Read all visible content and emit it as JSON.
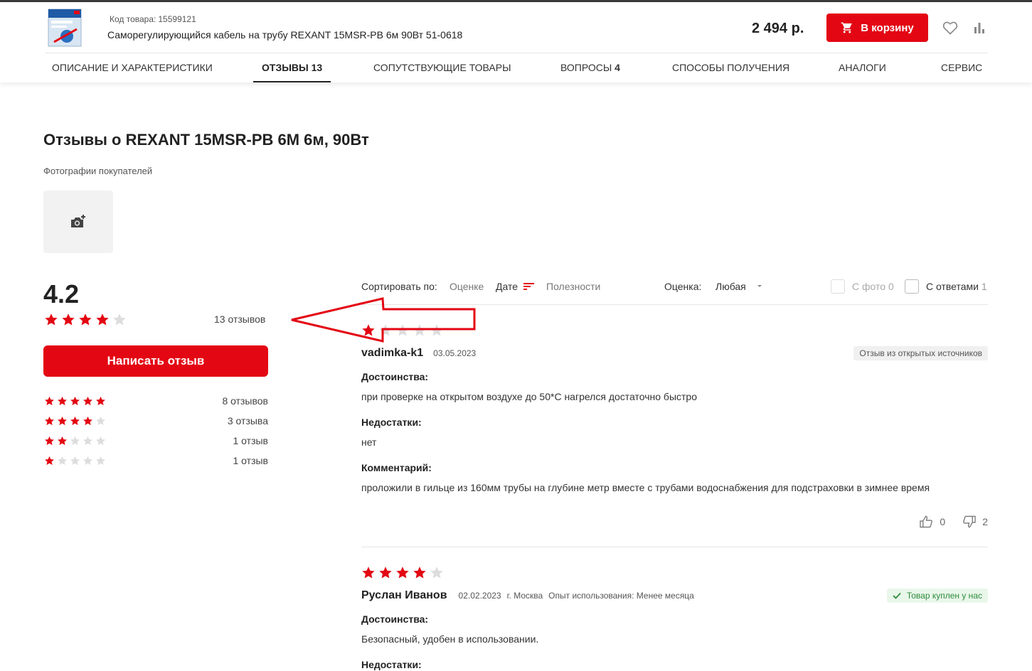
{
  "header": {
    "sku_label": "Код товара:",
    "sku_value": "15599121",
    "product_name": "Саморегулирующийся кабель на трубу REXANT 15MSR-PB 6м 90Вт 51-0618",
    "price": "2 494 р.",
    "cart_label": "В корзину",
    "icons": {
      "cart": "cart-icon",
      "favorite": "heart-icon",
      "compare": "compare-bars-icon"
    }
  },
  "tabs": [
    {
      "label": "ОПИСАНИЕ И ХАРАКТЕРИСТИКИ",
      "count": ""
    },
    {
      "label": "ОТЗЫВЫ",
      "count": "13",
      "active": true
    },
    {
      "label": "СОПУТСТВУЮЩИЕ ТОВАРЫ",
      "count": ""
    },
    {
      "label": "ВОПРОСЫ",
      "count": "4"
    },
    {
      "label": "СПОСОБЫ ПОЛУЧЕНИЯ",
      "count": ""
    },
    {
      "label": "АНАЛОГИ",
      "count": ""
    },
    {
      "label": "СЕРВИС",
      "count": ""
    }
  ],
  "main": {
    "title": "Отзывы о REXANT 15MSR-PB 6M 6м, 90Вт",
    "photos_label": "Фотографии покупателей",
    "add_photo_icon": "camera-plus-icon"
  },
  "summary": {
    "rating": "4.2",
    "rating_value": 4.2,
    "stars_filled": 4,
    "total_label": "13 отзывов",
    "write_button": "Написать отзыв",
    "distribution": [
      {
        "stars": 5,
        "label": "8 отзывов"
      },
      {
        "stars": 4,
        "label": "3 отзыва"
      },
      {
        "stars": 2,
        "label": "1 отзыв"
      },
      {
        "stars": 1,
        "label": "1 отзыв"
      }
    ]
  },
  "sort": {
    "label": "Сортировать по:",
    "options": [
      "Оценке",
      "Дате",
      "Полезности"
    ],
    "active": "Дате",
    "rating_filter_label": "Оценка:",
    "rating_filter_value": "Любая",
    "with_photo_label": "С фото",
    "with_photo_count": "0",
    "with_answers_label": "С ответами",
    "with_answers_count": "1"
  },
  "reviews": [
    {
      "stars": 1,
      "author": "vadimka-k1",
      "date": "03.05.2023",
      "city": "",
      "experience": "",
      "badge": "Отзыв из открытых источников",
      "pros_label": "Достоинства:",
      "pros": "при проверке на открытом воздухе до 50*С нагрелся достаточно быстро",
      "cons_label": "Недостатки:",
      "cons": "нет",
      "comment_label": "Комментарий:",
      "comment": "проложили в гильце из 160мм трубы на глубине метр вместе с трубами водоснабжения для подстраховки в зимнее время",
      "likes": "0",
      "dislikes": "2"
    },
    {
      "stars": 4,
      "author": "Руслан Иванов",
      "date": "02.02.2023",
      "city": "г. Москва",
      "experience": "Опыт использования: Менее месяца",
      "badge": "Товар куплен у нас",
      "pros_label": "Достоинства:",
      "pros": "Безопасный, удобен в использовании.",
      "cons_label": "Недостатки:"
    }
  ],
  "colors": {
    "accent": "#e30613",
    "star_empty": "#dddddd",
    "arrow": "#e30613",
    "badge_green_bg": "#e9f7ea",
    "badge_green_text": "#2e8b3a"
  }
}
